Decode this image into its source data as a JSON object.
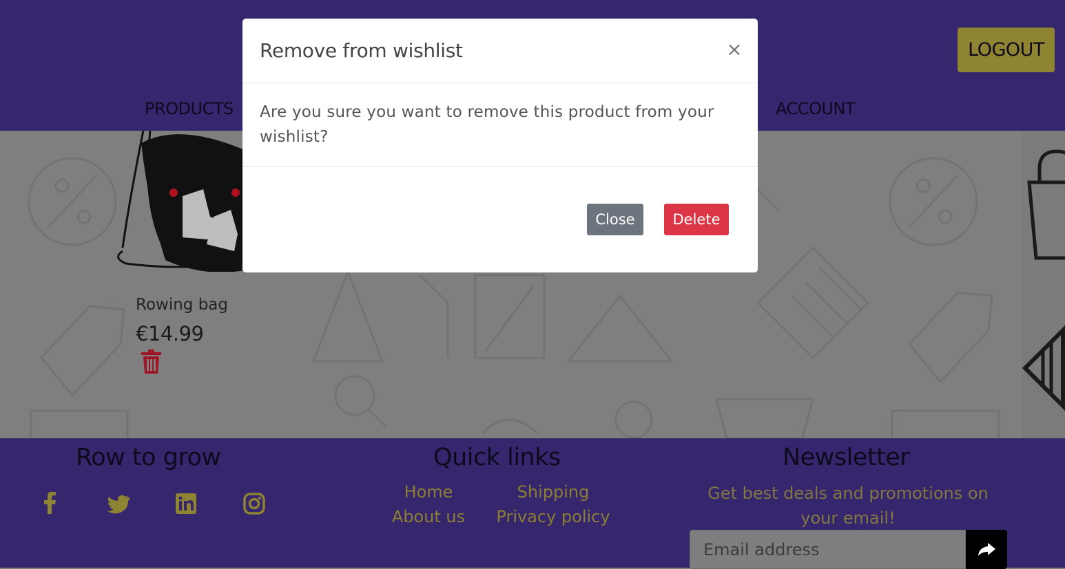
{
  "header": {
    "logout_label": "LOGOUT",
    "nav": {
      "products": "PRODUCTS",
      "account": "ACCOUNT"
    }
  },
  "product": {
    "name": "Rowing bag",
    "price": "€14.99",
    "delete_icon": "trash-icon"
  },
  "footer": {
    "brand_title": "Row to grow",
    "social": [
      "facebook-icon",
      "twitter-icon",
      "linkedin-icon",
      "instagram-icon"
    ],
    "quick_links_title": "Quick links",
    "links": {
      "home": "Home",
      "about": "About us",
      "shipping": "Shipping",
      "privacy": "Privacy policy"
    },
    "newsletter_title": "Newsletter",
    "newsletter_text": "Get best deals and promotions on your email!",
    "email_placeholder": "Email address",
    "submit_icon": "share-arrow-icon"
  },
  "modal": {
    "title": "Remove from wishlist",
    "close_glyph": "×",
    "body": "Are you sure you want to remove this product from your wishlist?",
    "close_label": "Close",
    "delete_label": "Delete"
  },
  "colors": {
    "header_bg": "#36266e",
    "logout_bg": "#8f8432",
    "footer_link": "#8a7f33",
    "danger": "#dc3545",
    "secondary": "#6c757d"
  }
}
